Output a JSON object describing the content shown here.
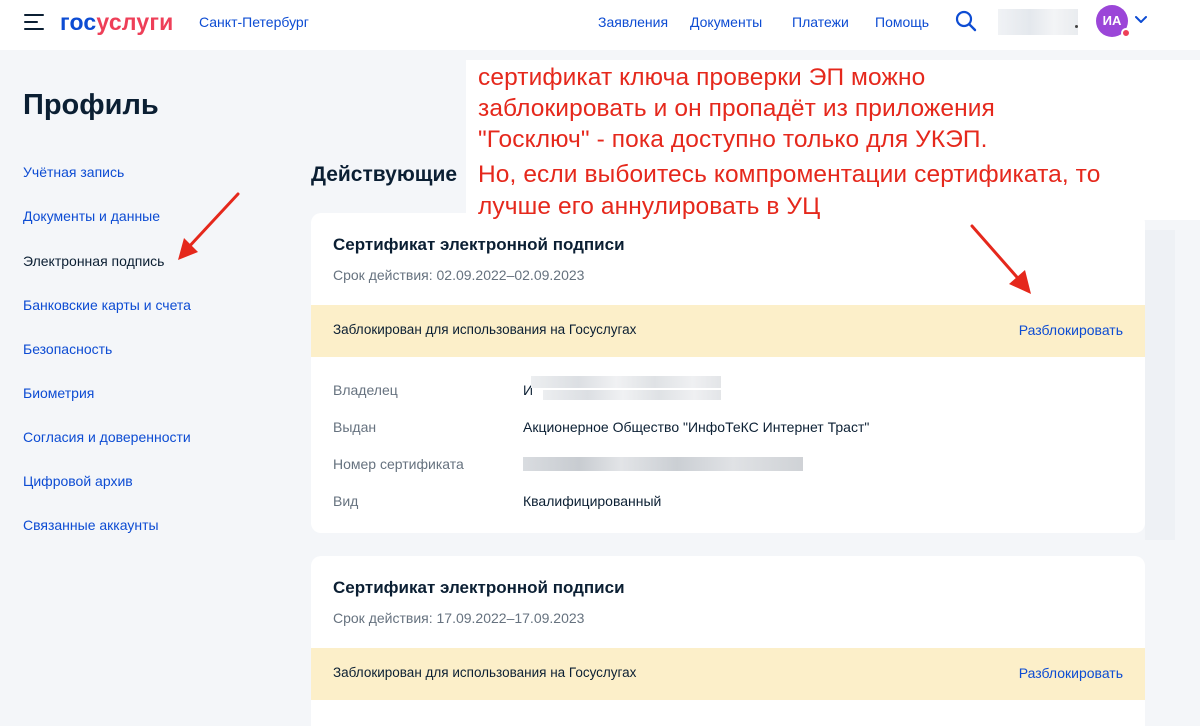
{
  "header": {
    "logo_part1": "гос",
    "logo_part2": "услуги",
    "city": "Санкт-Петербург",
    "nav": [
      {
        "label": "Заявления"
      },
      {
        "label": "Документы"
      },
      {
        "label": "Платежи"
      },
      {
        "label": "Помощь"
      }
    ],
    "search_icon": "search-icon",
    "avatar_initials": "ИА",
    "colors": {
      "brand_blue": "#0d4cd3",
      "brand_red": "#ee3f58",
      "avatar": "#9b46d8"
    }
  },
  "sidebar": {
    "title": "Профиль",
    "items": [
      {
        "label": "Учётная запись"
      },
      {
        "label": "Документы и данные"
      },
      {
        "label": "Электронная подпись",
        "active": true
      },
      {
        "label": "Банковские карты и счета"
      },
      {
        "label": "Безопасность"
      },
      {
        "label": "Биометрия"
      },
      {
        "label": "Согласия и доверенности"
      },
      {
        "label": "Цифровой архив"
      },
      {
        "label": "Связанные аккаунты"
      }
    ]
  },
  "main": {
    "section_title": "Действующие",
    "certificates": [
      {
        "title": "Сертификат электронной подписи",
        "validity": "Срок действия: 02.09.2022–02.09.2023",
        "status": "Заблокирован для использования на Госуслугах",
        "action": "Разблокировать",
        "fields": [
          {
            "label": "Владелец",
            "value": "И"
          },
          {
            "label": "Выдан",
            "value": "Акционерное Общество \"ИнфоТеКС Интернет Траст\""
          },
          {
            "label": "Номер сертификата",
            "value": ""
          },
          {
            "label": "Вид",
            "value": "Квалифицированный"
          }
        ]
      },
      {
        "title": "Сертификат электронной подписи",
        "validity": "Срок действия: 17.09.2022–17.09.2023",
        "status": "Заблокирован для использования на Госуслугах",
        "action": "Разблокировать"
      }
    ]
  },
  "annotation": {
    "lines": [
      "сертификат ключа проверки ЭП можно",
      "заблокировать и он пропадёт из приложения",
      "\"Госключ\" - пока доступно только для УКЭП.",
      "Но, если выбоитесь компроментации сертификата, то",
      "лучше его аннулировать в УЦ"
    ],
    "color": "#e5281c"
  }
}
